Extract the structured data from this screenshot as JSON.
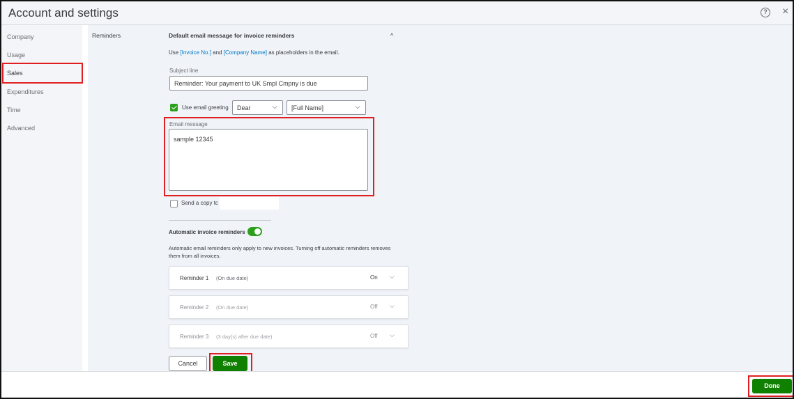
{
  "window": {
    "title": "Account and settings",
    "help_icon": "help-circle-icon",
    "close_icon": "close-icon",
    "close_glyph": "×",
    "help_glyph": "?"
  },
  "sidebar": {
    "items": [
      {
        "label": "Company"
      },
      {
        "label": "Usage"
      },
      {
        "label": "Sales"
      },
      {
        "label": "Expenditures"
      },
      {
        "label": "Time"
      },
      {
        "label": "Advanced"
      }
    ],
    "active": "Sales"
  },
  "section": {
    "label": "Reminders",
    "heading": "Default email message for invoice reminders",
    "caret_glyph": "^",
    "help_prefix": "Use ",
    "placeholder_invoice": "[Invoice No.]",
    "help_and": " and ",
    "placeholder_company": "[Company Name]",
    "help_suffix": " as placeholders in the email."
  },
  "subject": {
    "label": "Subject line",
    "value": "Reminder: Your payment to UK Smpl Cmpny is due"
  },
  "greeting": {
    "checkbox_label": "Use email greeting",
    "checked": true,
    "salutation": "Dear",
    "name_field": "[Full Name]"
  },
  "email_message": {
    "label": "Email message",
    "value": "sample 12345"
  },
  "send_copy": {
    "label": "Send a copy tc",
    "checked": false
  },
  "automatic": {
    "label": "Automatic invoice reminders",
    "enabled": true,
    "description": "Automatic email reminders only apply to new invoices. Turning off automatic reminders removes them from all invoices."
  },
  "reminders": [
    {
      "name": "Reminder 1",
      "detail": "(On due date)",
      "status": "On"
    },
    {
      "name": "Reminder 2",
      "detail": "(On due date)",
      "status": "Off"
    },
    {
      "name": "Reminder 3",
      "detail": "(3 day(s) after due date)",
      "status": "Off"
    }
  ],
  "actions": {
    "cancel_label": "Cancel",
    "save_label": "Save"
  },
  "footer": {
    "done_label": "Done"
  },
  "colors": {
    "accent_green": "#108000",
    "toggle_green": "#2ca01c",
    "link_blue": "#0077c5",
    "highlight_red": "#e02020"
  }
}
